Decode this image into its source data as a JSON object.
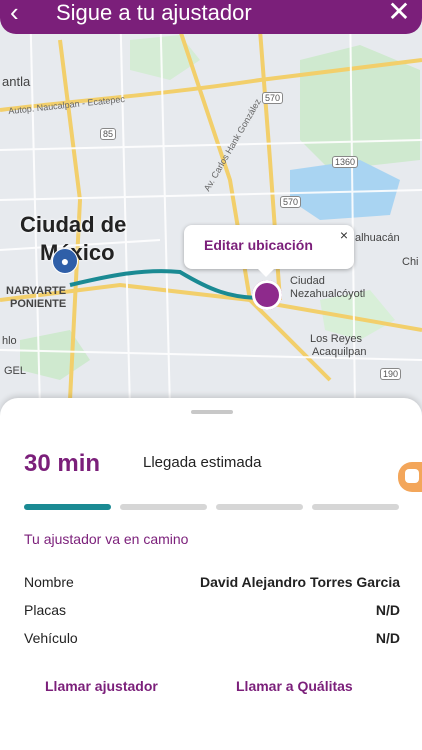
{
  "header": {
    "back_icon": "chevron-left-icon",
    "title": "Sigue a tu ajustador",
    "close_icon": "close-icon"
  },
  "map": {
    "labels": {
      "city_main_line1": "Ciudad de",
      "city_main_line2": "México",
      "narvarte_line1": "NARVARTE",
      "narvarte_line2": "PONIENTE",
      "tlalnepantla": "antla",
      "nezahualcoyotl_line1": "Ciudad",
      "nezahualcoyotl_line2": "Nezahualcóyotl",
      "los_reyes_line1": "Los Reyes",
      "los_reyes_line2": "Acaquilpan",
      "chalhuacan": "alhuacán",
      "chi": "Chi",
      "hlo": "hlo",
      "gel": "GEL",
      "road1": "Autop. Naucalpan - Ecatepec",
      "road2": "Av. Carlos Hank González",
      "shield_570": "570",
      "shield_85": "85",
      "shield_1360": "1360",
      "shield_570b": "570",
      "shield_190": "190"
    },
    "tooltip": {
      "text": "Editar ubicación",
      "close": "×"
    }
  },
  "sheet": {
    "eta_time": "30 min",
    "eta_label": "Llegada estimada",
    "progress": {
      "active_segments": 1,
      "total_segments": 4
    },
    "status": "Tu ajustador va en camino",
    "details": [
      {
        "label": "Nombre",
        "value": "David Alejandro Torres Garcia"
      },
      {
        "label": "Placas",
        "value": "N/D"
      },
      {
        "label": "Vehículo",
        "value": "N/D"
      }
    ],
    "actions": {
      "call_adjuster": "Llamar ajustador",
      "call_qualitas": "Llamar a Quálitas"
    }
  },
  "colors": {
    "brand_purple": "#7b1f7a",
    "route_teal": "#1a8a93",
    "chat_orange": "#f3a65a"
  }
}
